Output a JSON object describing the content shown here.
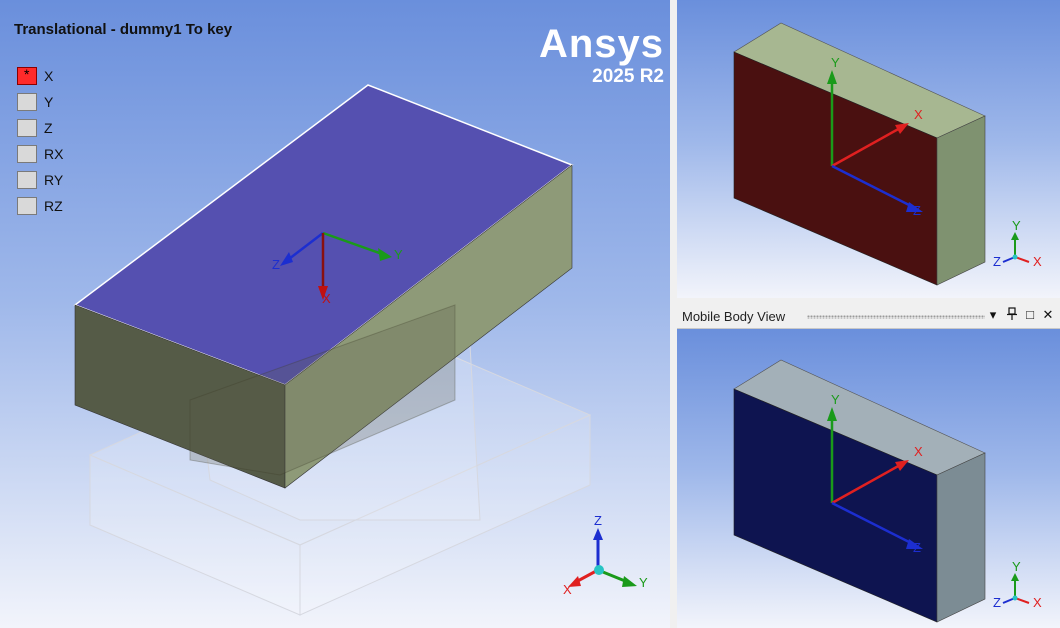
{
  "connection_title": "Translational - dummy1 To key",
  "dof_items": [
    {
      "label": "X",
      "active": true
    },
    {
      "label": "Y",
      "active": false
    },
    {
      "label": "Z",
      "active": false
    },
    {
      "label": "RX",
      "active": false
    },
    {
      "label": "RY",
      "active": false
    },
    {
      "label": "RZ",
      "active": false
    }
  ],
  "logo": {
    "name": "Ansys",
    "version": "2025 R2"
  },
  "main_viewport": {
    "joint_axes": {
      "x": "X",
      "y": "Y",
      "z": "Z"
    },
    "triad": {
      "x": "X",
      "y": "Y",
      "z": "Z"
    }
  },
  "reference_viewport": {
    "axes": {
      "x": "X",
      "y": "Y",
      "z": "Z"
    },
    "triad": {
      "x": "X",
      "y": "Y",
      "z": "Z"
    }
  },
  "mobile_panel": {
    "title": "Mobile Body View",
    "buttons": {
      "dropdown": "▾",
      "pin": "ᵖ",
      "maximize": "□",
      "close": "✕"
    },
    "axes": {
      "x": "X",
      "y": "Y",
      "z": "Z"
    },
    "triad": {
      "x": "X",
      "y": "Y",
      "z": "Z"
    }
  },
  "colors": {
    "x_axis": "#e02020",
    "y_axis": "#1a9a1a",
    "z_axis": "#1c2ed0",
    "active_dof": "#ff2a2a",
    "top_face": "#5550b0",
    "reference_face": "#4a1010",
    "mobile_face": "#0e1450"
  }
}
